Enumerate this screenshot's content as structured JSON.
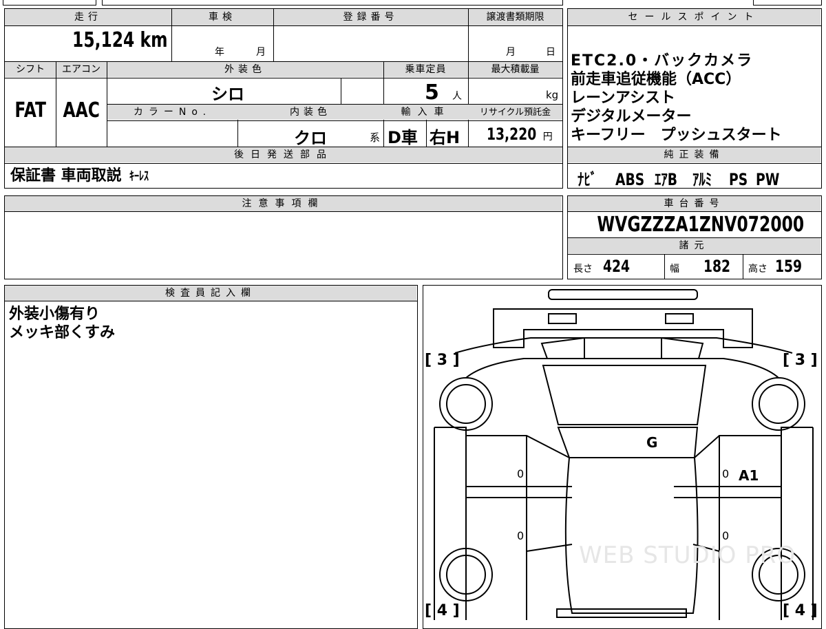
{
  "vehicle": {
    "mileage_header": "走行",
    "mileage_value": "15,124",
    "mileage_unit": "km",
    "inspection_header": "車検",
    "inspection_year_unit": "年",
    "inspection_month_unit": "月",
    "registration_header": "登録番号",
    "transfer_deadline_header": "譲渡書類期限",
    "transfer_month_unit": "月",
    "transfer_day_unit": "日",
    "shift_header": "シフト",
    "shift_value": "FAT",
    "aircon_header": "エアコン",
    "aircon_value": "AAC",
    "exterior_color_header": "外装色",
    "exterior_color_value": "シロ",
    "color_no_header": "カラーNo.",
    "interior_color_header": "内装色",
    "interior_color_value": "クロ",
    "interior_color_suffix": "系",
    "capacity_header": "乗車定員",
    "capacity_value": "5",
    "capacity_unit": "人",
    "max_load_header": "最大積載量",
    "max_load_unit": "kg",
    "import_header": "輸入車",
    "import_value": "D車",
    "steering_value": "右H",
    "recycle_header": "リサイクル預託金",
    "recycle_value": "13,220",
    "recycle_unit": "円"
  },
  "sales_points": {
    "header": "セールスポイント",
    "lines": [
      "ETC2.0・バックカメラ",
      "前走車追従機能（ACC）",
      "レーンアシスト",
      "デジタルメーター",
      "キーフリー　プッシュスタート"
    ]
  },
  "later_parts": {
    "header": "後日発送部品",
    "value": "保証書 車両取説",
    "value_small": "ｷｰﾚｽ"
  },
  "genuine_equipment": {
    "header": "純正装備",
    "items": [
      "ﾅﾋﾞ",
      "ABS",
      "ｴｱB",
      "ｱﾙﾐ",
      "PS",
      "PW"
    ]
  },
  "notes": {
    "header": "注意事項欄",
    "value": ""
  },
  "chassis": {
    "header": "車台番号",
    "value": "WVGZZZA1ZNV072000",
    "specs_header": "諸元",
    "length_label": "長さ",
    "length_value": "424",
    "width_label": "幅",
    "width_value": "182",
    "height_label": "高さ",
    "height_value": "159"
  },
  "inspector": {
    "header": "検査員記入欄",
    "lines": [
      "外装小傷有り",
      "メッキ部くすみ"
    ]
  },
  "diagram": {
    "tire_fl": "[ 3 ]",
    "tire_fr": "[ 3 ]",
    "tire_rl": "[ 4 ]",
    "tire_rr": "[ 4 ]",
    "mark_windshield": "G",
    "mark_right_door": "A1",
    "zero_l1": "0",
    "zero_l2": "0",
    "zero_r1": "0",
    "zero_r2": "0",
    "watermark": "WEB STUDIO PRO"
  }
}
